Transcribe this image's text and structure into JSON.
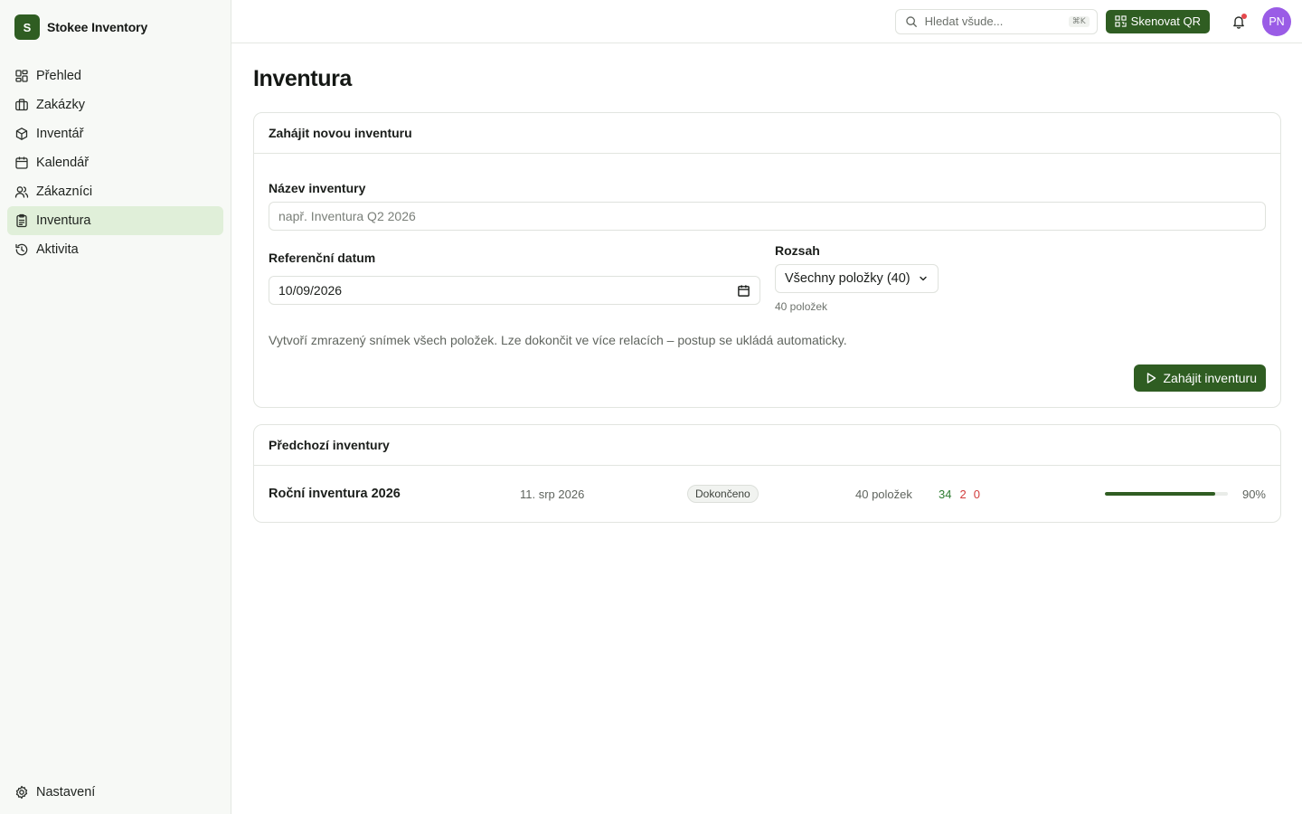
{
  "brand": {
    "logo_letter": "S",
    "name": "Stokee Inventory"
  },
  "sidebar": {
    "items": [
      {
        "label": "Přehled",
        "icon": "dashboard-icon"
      },
      {
        "label": "Zakázky",
        "icon": "briefcase-icon"
      },
      {
        "label": "Inventář",
        "icon": "box-icon"
      },
      {
        "label": "Kalendář",
        "icon": "calendar-icon"
      },
      {
        "label": "Zákazníci",
        "icon": "users-icon"
      },
      {
        "label": "Inventura",
        "icon": "clipboard-icon",
        "active": true
      },
      {
        "label": "Aktivita",
        "icon": "history-icon"
      }
    ],
    "settings_label": "Nastavení"
  },
  "topbar": {
    "search_placeholder": "Hledat všude...",
    "search_shortcut": "⌘K",
    "scan_label": "Skenovat QR",
    "avatar_initials": "PN",
    "avatar_color": "#9a5ce6",
    "has_notification": true
  },
  "page": {
    "title": "Inventura"
  },
  "new_inventory": {
    "header": "Zahájit novou inventuru",
    "name_label": "Název inventury",
    "name_placeholder": "např. Inventura Q2 2026",
    "name_value": "",
    "date_label": "Referenční datum",
    "date_value": "10/09/2026",
    "scope_label": "Rozsah",
    "scope_value": "Všechny položky (40)",
    "scope_helper": "40 položek",
    "description": "Vytvoří zmrazený snímek všech položek. Lze dokončit ve více relacích – postup se ukládá automaticky.",
    "start_button": "Zahájit inventuru"
  },
  "previous": {
    "header": "Předchozí inventury",
    "rows": [
      {
        "name": "Roční inventura 2026",
        "date": "11. srp 2026",
        "status": "Dokončeno",
        "items": "40 položek",
        "count_ok": "34",
        "count_diff": "2",
        "count_missing": "0",
        "progress_percent": 90,
        "progress_label": "90%"
      }
    ]
  },
  "colors": {
    "accent": "#2f5d22",
    "active_nav_bg": "#e0efd9",
    "ok": "#2f7d32",
    "error": "#d23c3c"
  }
}
